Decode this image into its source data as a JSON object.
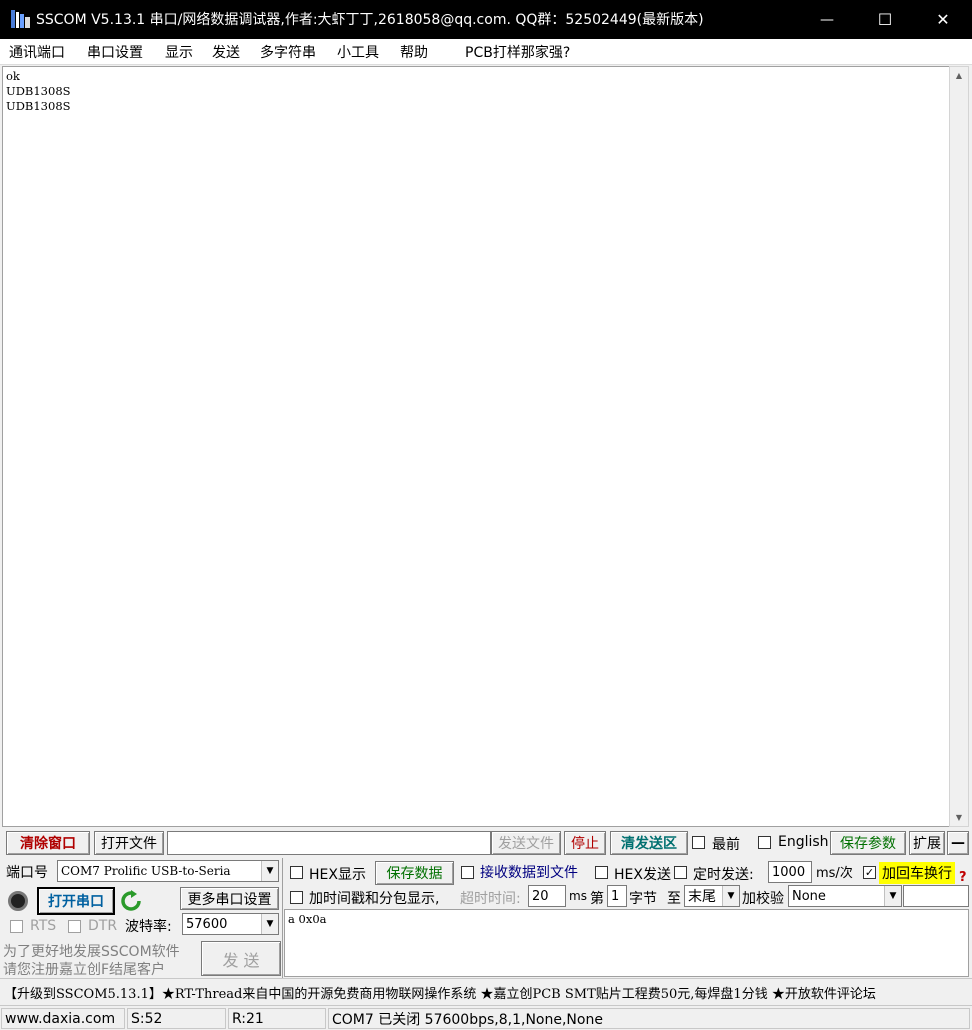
{
  "window": {
    "title": "SSCOM V5.13.1 串口/网络数据调试器,作者:大虾丁丁,2618058@qq.com. QQ群：52502449(最新版本)",
    "minimize_glyph": "—",
    "maximize_glyph": "☐",
    "close_glyph": "✕"
  },
  "menu": {
    "items": [
      "通讯端口",
      "串口设置",
      "显示",
      "发送",
      "多字符串",
      "小工具",
      "帮助",
      "PCB打样那家强?"
    ]
  },
  "receive": {
    "text": "ok\nUDB1308S\nUDB1308S"
  },
  "toolbar": {
    "clear_label": "清除窗口",
    "open_file_label": "打开文件",
    "file_path": "",
    "send_file_label": "发送文件",
    "stop_label": "停止",
    "clear_send_label": "清发送区",
    "topmost_label": "最前",
    "english_label": "English",
    "save_params_label": "保存参数",
    "expand_label": "扩展",
    "collapse_label": "—"
  },
  "port": {
    "port_label": "端口号",
    "port_value": "COM7 Prolific USB-to-Seria",
    "open_port_label": "打开串口",
    "more_settings_label": "更多串口设置",
    "rts_label": "RTS",
    "dtr_label": "DTR",
    "baud_label": "波特率:",
    "baud_value": "57600",
    "promo_line1": "为了更好地发展SSCOM软件",
    "promo_line2": "请您注册嘉立创F结尾客户",
    "send_label": "发  送"
  },
  "options": {
    "hex_display_label": "HEX显示",
    "save_data_label": "保存数据",
    "recv_to_file_label": "接收数据到文件",
    "hex_send_label": "HEX发送",
    "timed_send_label": "定时发送:",
    "interval_value": "1000",
    "interval_unit": "ms/次",
    "add_crlf_label": "加回车换行",
    "crlf_checked": "✓",
    "timestamp_label": "加时间戳和分包显示,",
    "timeout_label": "超时时间:",
    "timeout_value": "20",
    "timeout_unit": "ms",
    "byte_prefix": "第",
    "byte_value": "1",
    "byte_suffix": "字节",
    "to_label": "至",
    "to_value": "末尾",
    "checksum_label": "加校验",
    "checksum_value": "None",
    "help_glyph": "?"
  },
  "send": {
    "text": "a 0x0a"
  },
  "ad": {
    "text": "【升级到SSCOM5.13.1】★RT-Thread来自中国的开源免费商用物联网操作系统 ★嘉立创PCB SMT贴片工程费50元,每焊盘1分钱 ★开放软件评论坛"
  },
  "status": {
    "website": "www.daxia.com",
    "sent": "S:52",
    "received": "R:21",
    "port_status": "COM7 已关闭  57600bps,8,1,None,None"
  },
  "colors": {
    "titlebar_bg": "#000000",
    "crlf_highlight": "#ffff00",
    "red_button": "#b00000",
    "green_button": "#007000"
  }
}
